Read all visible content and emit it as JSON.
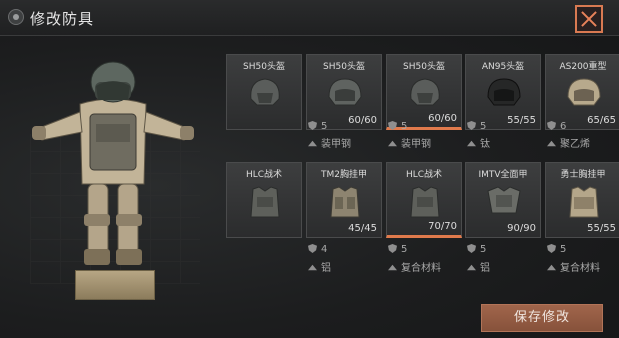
{
  "header": {
    "title": "修改防具"
  },
  "helmets": [
    {
      "name": "SH50头盔",
      "durability": "",
      "armor_class": "",
      "material": "",
      "selected": false
    },
    {
      "name": "SH50头盔",
      "durability": "60/60",
      "armor_class": "5",
      "material": "装甲钢",
      "selected": false
    },
    {
      "name": "SH50头盔",
      "durability": "60/60",
      "armor_class": "5",
      "material": "装甲钢",
      "selected": true
    },
    {
      "name": "AN95头盔",
      "durability": "55/55",
      "armor_class": "5",
      "material": "钛",
      "selected": false
    },
    {
      "name": "AS200重型",
      "durability": "65/65",
      "armor_class": "6",
      "material": "聚乙烯",
      "selected": false
    }
  ],
  "vests": [
    {
      "name": "HLC战术",
      "durability": "",
      "armor_class": "",
      "material": "",
      "selected": false
    },
    {
      "name": "TM2胸挂甲",
      "durability": "45/45",
      "armor_class": "4",
      "material": "铝",
      "selected": false
    },
    {
      "name": "HLC战术",
      "durability": "70/70",
      "armor_class": "5",
      "material": "复合材料",
      "selected": true
    },
    {
      "name": "IMTV全面甲",
      "durability": "90/90",
      "armor_class": "5",
      "material": "铝",
      "selected": false
    },
    {
      "name": "勇士胸挂甲",
      "durability": "55/55",
      "armor_class": "5",
      "material": "复合材料",
      "selected": false
    }
  ],
  "footer": {
    "save_label": "保存修改"
  },
  "icons": {
    "close": "close-icon",
    "logo": "game-logo-icon",
    "armor_class": "shield-icon",
    "material": "material-icon"
  },
  "colors": {
    "accent": "#e07a4c",
    "save_button": "#8f563f"
  }
}
